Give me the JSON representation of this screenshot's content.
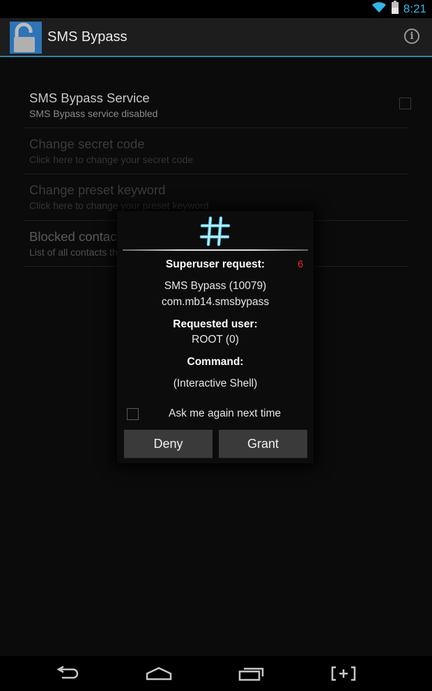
{
  "status_bar": {
    "time": "8:21",
    "icons": [
      "wifi-icon",
      "battery-icon"
    ]
  },
  "action_bar": {
    "title": "SMS Bypass",
    "app_icon": "padlock-icon",
    "info_icon": "info-icon",
    "info_glyph": "i"
  },
  "preferences": [
    {
      "title": "SMS Bypass Service",
      "summary": "SMS Bypass service disabled",
      "enabled": true,
      "checked": false
    },
    {
      "title": "Change secret code",
      "summary": "Click here to change your secret code",
      "enabled": false
    },
    {
      "title": "Change preset keyword",
      "summary": "Click here to change your preset keyword",
      "enabled": false
    },
    {
      "title": "Blocked contacts",
      "summary": "List of all contacts that you blocked",
      "enabled": true
    }
  ],
  "dialog": {
    "icon": "hash-icon",
    "heading": "Superuser request:",
    "countdown": "6",
    "app_name": "SMS Bypass (10079)",
    "package": "com.mb14.smsbypass",
    "requested_user_label": "Requested user:",
    "requested_user": "ROOT (0)",
    "command_label": "Command:",
    "command": "(Interactive Shell)",
    "ask_again_label": "Ask me again next time",
    "ask_again_checked": false,
    "deny_label": "Deny",
    "grant_label": "Grant"
  },
  "nav_bar": {
    "buttons": [
      "back-icon",
      "home-icon",
      "recents-icon",
      "screenshot-icon"
    ]
  },
  "colors": {
    "accent": "#33b5e5",
    "countdown": "#e22222",
    "button_bg": "#3a3a3a"
  }
}
